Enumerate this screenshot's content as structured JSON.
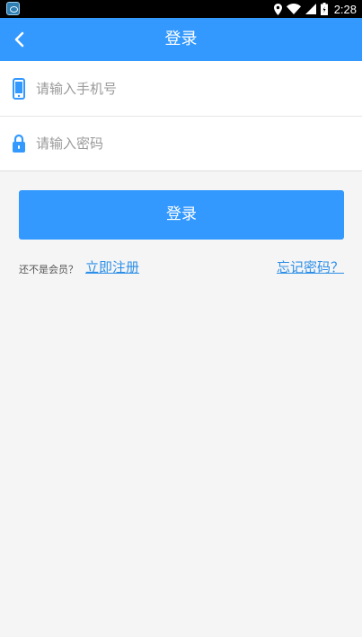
{
  "status_bar": {
    "time": "2:28",
    "icons": [
      "app-icon",
      "location-icon",
      "wifi-icon",
      "signal-icon",
      "battery-icon"
    ]
  },
  "app_bar": {
    "title": "登录",
    "back_icon": "chevron-left-icon"
  },
  "form": {
    "phone": {
      "placeholder": "请输入手机号",
      "value": "",
      "icon": "phone-icon"
    },
    "password": {
      "placeholder": "请输入密码",
      "value": "",
      "icon": "lock-icon"
    }
  },
  "login_button": {
    "label": "登录"
  },
  "links": {
    "not_member": "还不是会员？",
    "register": "立即注册",
    "forgot": "忘记密码？"
  },
  "colors": {
    "primary": "#3399ff",
    "link": "#2d8fe8",
    "background": "#f5f5f5"
  }
}
